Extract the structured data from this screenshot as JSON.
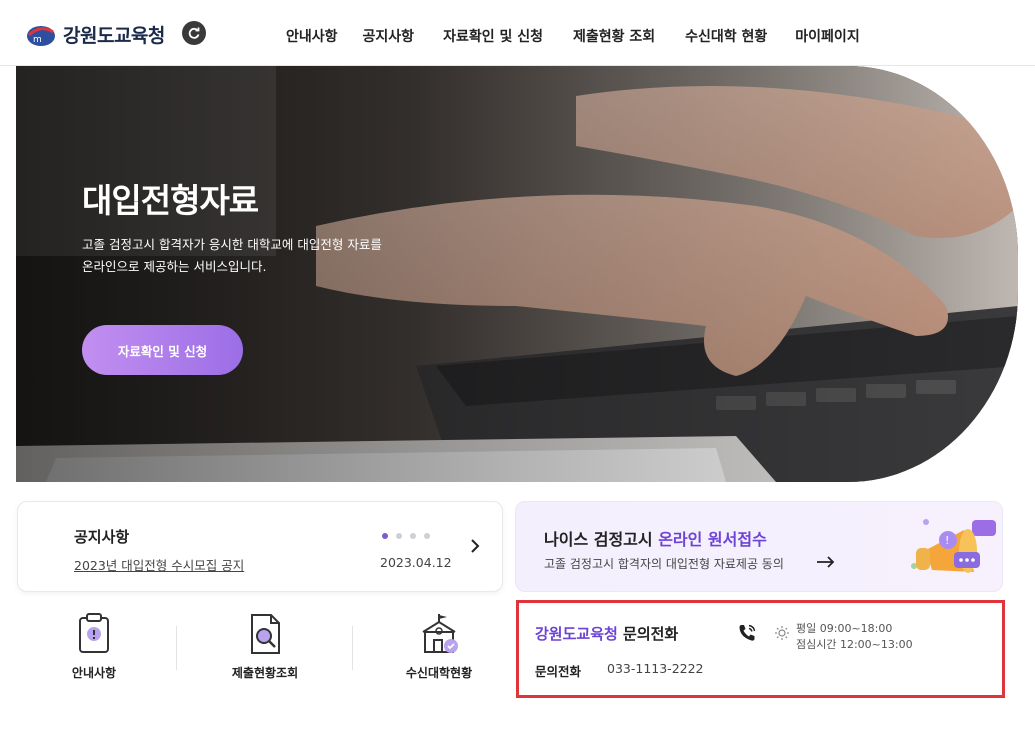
{
  "header": {
    "logo_text": "강원도교육청",
    "nav": [
      "안내사항",
      "공지사항",
      "자료확인 및 신청",
      "제출현황 조회",
      "수신대학 현황",
      "마이페이지"
    ]
  },
  "hero": {
    "title": "대입전형자료",
    "desc_line1": "고졸 검정고시 합격자가 응시한 대학교에 대입전형 자료를",
    "desc_line2": "온라인으로 제공하는 서비스입니다.",
    "button": "자료확인 및 신청"
  },
  "notice": {
    "title": "공지사항",
    "item_title": "2023년 대입전형 수시모집 공지",
    "item_date": "2023.04.12"
  },
  "promo": {
    "title_plain": "나이스 검정고시 ",
    "title_highlight": "온라인 원서접수",
    "subtitle": "고졸 검정고시 합격자의 대입전형 자료제공 동의"
  },
  "quick_links": [
    "안내사항",
    "제출현황조회",
    "수신대학현황"
  ],
  "contact": {
    "title_highlight": "강원도교육청",
    "title_plain": " 문의전화",
    "label": "문의전화",
    "phone": "033-1113-2222",
    "hours_line1": "평일 09:00~18:00",
    "hours_line2": "점심시간 12:00~13:00"
  },
  "colors": {
    "accent": "#6d43d6",
    "button_gradient_start": "#c28ff0",
    "button_gradient_end": "#9c6ee6",
    "highlight_border": "#e0343b"
  }
}
